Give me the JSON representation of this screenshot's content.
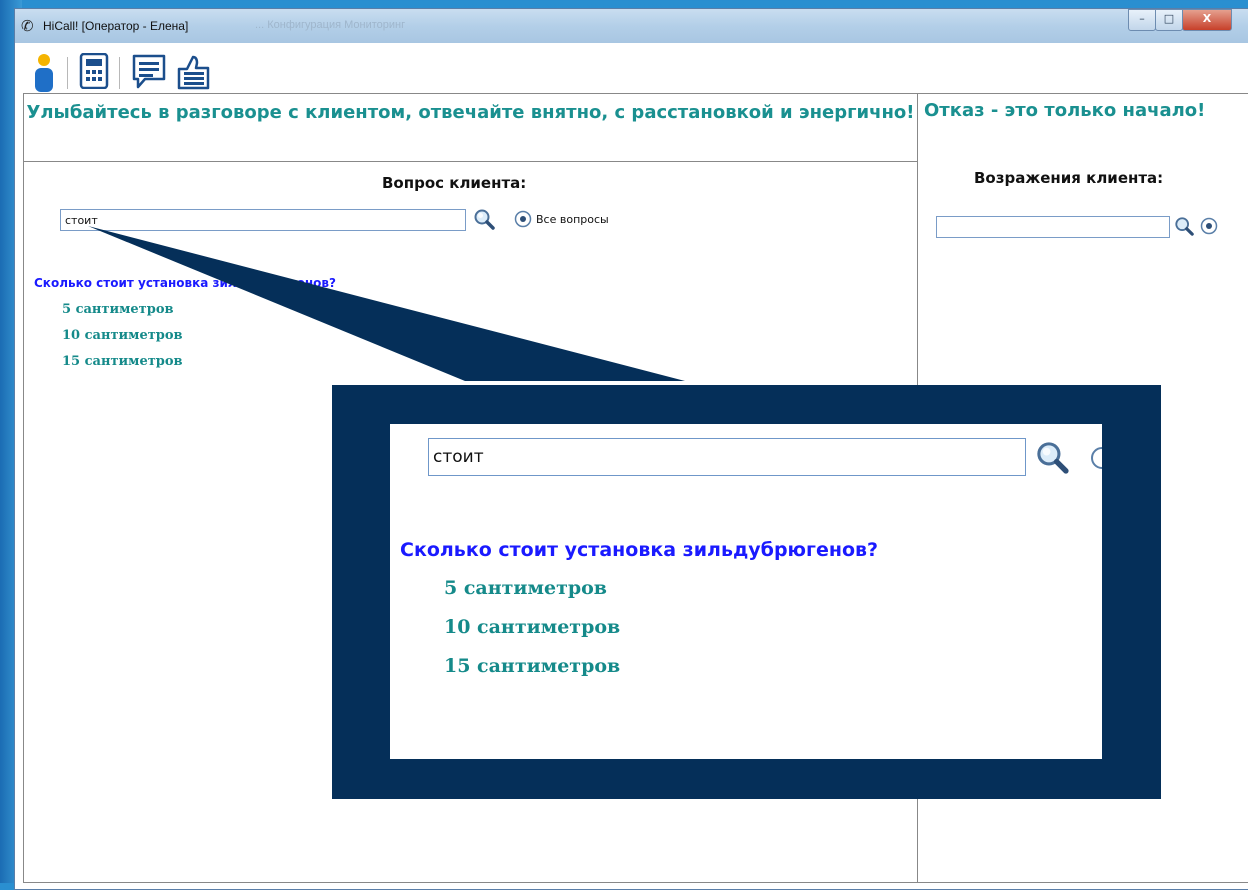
{
  "window": {
    "title": "HiCall!  [Оператор - Елена]",
    "ghost_menu": "...           Конфигурация   Мониторинг",
    "buttons": {
      "minimize": "–",
      "maximize": "□",
      "close": "X"
    }
  },
  "toolbar": {
    "icons": [
      "operator-icon",
      "calculator-icon",
      "chat-icon",
      "thumbs-up-icon"
    ]
  },
  "left_panel": {
    "banner": "Улыбайтесь в разговоре с клиентом, отвечайте внятно, с расстановкой и энергично!",
    "section_title": "Вопрос клиента:",
    "search_value": "стоит",
    "all_questions_label": "Все вопросы",
    "question": "Сколько стоит установка зильдубрюгенов?",
    "answers": [
      "5 сантиметров",
      "10 сантиметров",
      "15 сантиметров"
    ]
  },
  "right_panel": {
    "banner": "Отказ - это только начало!",
    "section_title": "Возражения клиента:",
    "search_value": ""
  },
  "callout": {
    "search_value": "стоит",
    "question": "Сколько стоит установка зильдубрюгенов?",
    "answers": [
      "5 сантиметров",
      "10 сантиметров",
      "15 сантиметров"
    ]
  },
  "colors": {
    "banner_teal": "#1a9090",
    "question_blue": "#1a1aff",
    "answer_teal": "#158a8a",
    "callout_navy": "#052f59"
  }
}
